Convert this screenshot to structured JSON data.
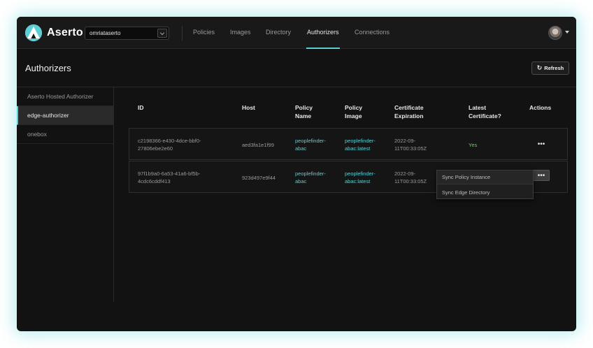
{
  "app": {
    "brand": "Aserto",
    "tenant": "omriataserto"
  },
  "nav": {
    "tabs": [
      {
        "label": "Policies"
      },
      {
        "label": "Images"
      },
      {
        "label": "Directory"
      },
      {
        "label": "Authorizers",
        "active": true
      },
      {
        "label": "Connections"
      }
    ]
  },
  "page": {
    "title": "Authorizers",
    "refresh_label": "Refresh"
  },
  "sidebar": {
    "items": [
      {
        "label": "Aserto Hosted Authorizer"
      },
      {
        "label": "edge-authorizer",
        "active": true
      },
      {
        "label": "onebox"
      }
    ]
  },
  "table": {
    "headers": {
      "id": "ID",
      "host": "Host",
      "policy_name": "Policy Name",
      "policy_image": "Policy Image",
      "cert_exp": "Certificate Expiration",
      "latest_cert": "Latest Certificate?",
      "actions": "Actions"
    },
    "rows": [
      {
        "id_l1": "c2198366-e430-4dce-bbf0-",
        "id_l2": "27806ebe2e60",
        "host": "aed3fa1e1f99",
        "policy_name_l1": "peoplefinder-",
        "policy_name_l2": "abac",
        "policy_image_l1": "peoplefinder-",
        "policy_image_l2": "abac:latest",
        "cert_exp_l1": "2022-09-",
        "cert_exp_l2": "11T00:33:05Z",
        "latest_cert": "Yes",
        "actions": "•••"
      },
      {
        "id_l1": "97f1b9a0-6a53-41a6-bf5b-",
        "id_l2": "4cdc6cddf413",
        "host": "923d497e9f44",
        "policy_name_l1": "peoplefinder-",
        "policy_name_l2": "abac",
        "policy_image_l1": "peoplefinder-",
        "policy_image_l2": "abac:latest",
        "cert_exp_l1": "2022-09-",
        "cert_exp_l2": "11T00:33:05Z",
        "actions": "•••"
      }
    ]
  },
  "dropdown": {
    "items": [
      {
        "label": "Sync Policy Instance"
      },
      {
        "label": "Sync Edge Directory"
      }
    ]
  },
  "colors": {
    "accent": "#5ccfd4",
    "success": "#5fd35f",
    "background": "#121212"
  }
}
